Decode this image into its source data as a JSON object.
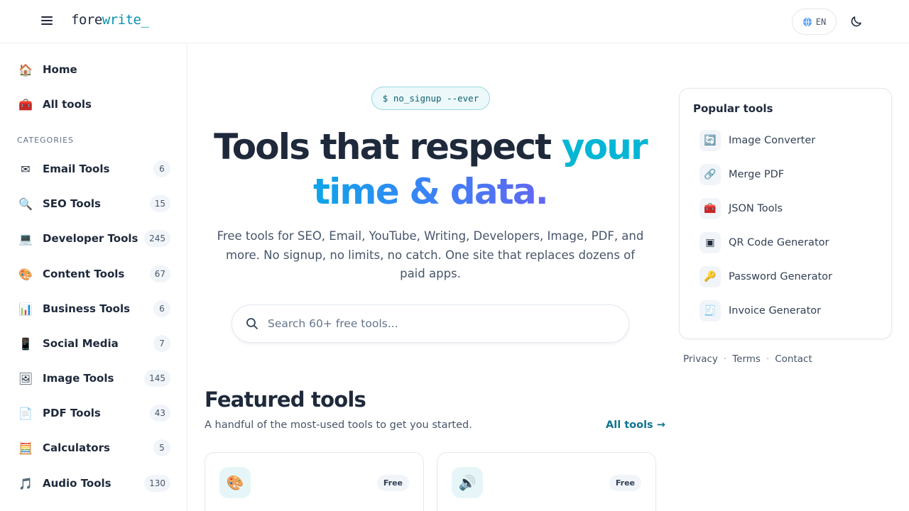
{
  "header": {
    "logo_part1": "fore",
    "logo_part2": "write_",
    "lang_label": "EN"
  },
  "sidebar": {
    "top_items": [
      {
        "label": "Home",
        "icon": "house-icon",
        "glyph": "🏠"
      },
      {
        "label": "All tools",
        "icon": "toolbox-icon",
        "glyph": "🧰"
      }
    ],
    "categories_heading": "CATEGORIES",
    "categories": [
      {
        "label": "Email Tools",
        "count": "6",
        "icon": "envelope-icon",
        "glyph": "✉"
      },
      {
        "label": "SEO Tools",
        "count": "15",
        "icon": "magnifier-icon",
        "glyph": "🔍"
      },
      {
        "label": "Developer Tools",
        "count": "245",
        "icon": "monitor-icon",
        "glyph": "💻"
      },
      {
        "label": "Content Tools",
        "count": "67",
        "icon": "palette-icon",
        "glyph": "🎨"
      },
      {
        "label": "Business Tools",
        "count": "6",
        "icon": "bar-chart-icon",
        "glyph": "📊"
      },
      {
        "label": "Social Media",
        "count": "7",
        "icon": "phone-icon",
        "glyph": "📱"
      },
      {
        "label": "Image Tools",
        "count": "145",
        "icon": "picture-icon",
        "glyph": "🖼"
      },
      {
        "label": "PDF Tools",
        "count": "43",
        "icon": "document-icon",
        "glyph": "📄"
      },
      {
        "label": "Calculators",
        "count": "5",
        "icon": "abacus-icon",
        "glyph": "🧮"
      },
      {
        "label": "Audio Tools",
        "count": "130",
        "icon": "music-note-icon",
        "glyph": "🎵"
      }
    ]
  },
  "hero": {
    "pill": "$ no_signup --ever",
    "title_part1": "Tools that respect ",
    "title_part2": "your",
    "title_part3": "time & data.",
    "subtitle": "Free tools for SEO, Email, YouTube, Writing, Developers, Image, PDF, and more. No signup, no limits, no catch. One site that replaces dozens of paid apps."
  },
  "search": {
    "placeholder": "Search 60+ free tools...",
    "value": ""
  },
  "featured": {
    "title": "Featured tools",
    "subtitle": "A handful of the most-used tools to get you started.",
    "link": "All tools →",
    "cards": [
      {
        "badge": "Free",
        "icon": "palette-icon",
        "glyph": "🎨"
      },
      {
        "badge": "Free",
        "icon": "speaker-icon",
        "glyph": "🔊"
      }
    ]
  },
  "popular": {
    "title": "Popular tools",
    "items": [
      {
        "label": "Image Converter",
        "icon": "refresh-icon",
        "glyph": "🔄"
      },
      {
        "label": "Merge PDF",
        "icon": "link-icon",
        "glyph": "🔗"
      },
      {
        "label": "JSON Tools",
        "icon": "toolbox-icon",
        "glyph": "🧰"
      },
      {
        "label": "QR Code Generator",
        "icon": "qr-code-icon",
        "glyph": "▣"
      },
      {
        "label": "Password Generator",
        "icon": "key-icon",
        "glyph": "🔑"
      },
      {
        "label": "Invoice Generator",
        "icon": "receipt-icon",
        "glyph": "🧾"
      }
    ]
  },
  "footer": {
    "links": [
      "Privacy",
      "Terms",
      "Contact"
    ],
    "separator": "·"
  },
  "colors": {
    "accent": "#06b6d4",
    "link": "#0e7490",
    "text": "#1e293b"
  }
}
